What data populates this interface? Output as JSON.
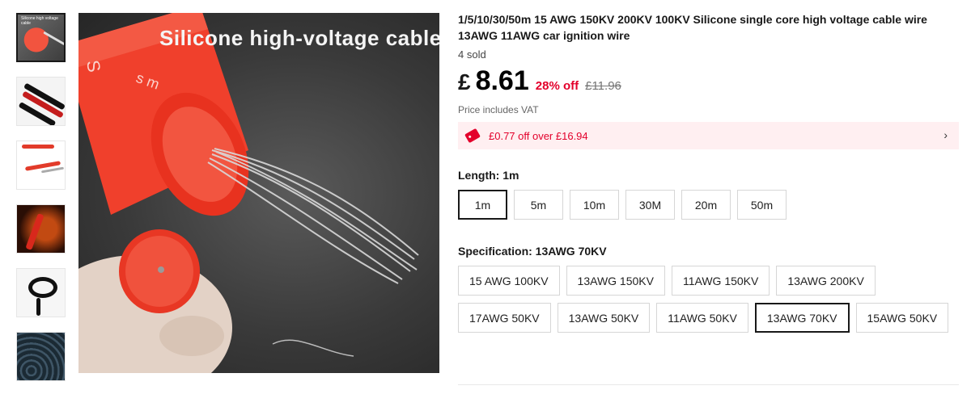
{
  "gallery": {
    "main_caption": "Silicone high-voltage cable",
    "thumb_caption": "Silicone high voltage cable"
  },
  "product": {
    "title": "1/5/10/30/50m 15 AWG 150KV 200KV 100KV Silicone single core high voltage cable wire 13AWG 11AWG car ignition wire",
    "sold": "4 sold",
    "currency": "£",
    "price": "8.61",
    "discount": "28% off",
    "original_price": "£11.96",
    "vat_note": "Price includes VAT",
    "coupon": "£0.77 off over £16.94",
    "accent_color": "#e3002b"
  },
  "length": {
    "label": "Length: 1m",
    "options": [
      "1m",
      "5m",
      "10m",
      "30M",
      "20m",
      "50m"
    ],
    "selected": "1m"
  },
  "specification": {
    "label": "Specification: 13AWG 70KV",
    "options": [
      "15 AWG 100KV",
      "13AWG 150KV",
      "11AWG 150KV",
      "13AWG 200KV",
      "17AWG 50KV",
      "13AWG 50KV",
      "11AWG 50KV",
      "13AWG 70KV",
      "15AWG 50KV"
    ],
    "selected": "13AWG 70KV"
  },
  "icons": [
    "coupon-tag-icon",
    "chevron-right-icon"
  ]
}
